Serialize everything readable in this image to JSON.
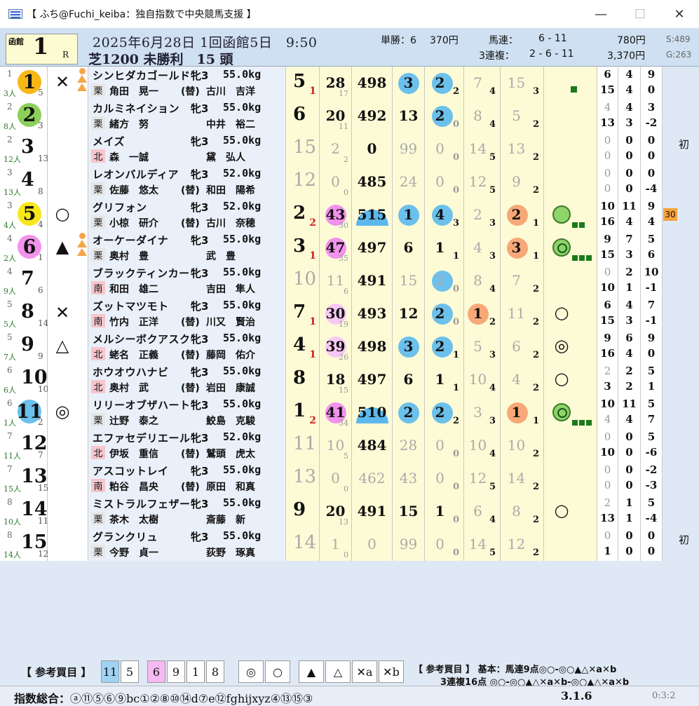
{
  "window": {
    "title": "【 ふち@Fuchi_keiba：独自指数で中央競馬支援 】",
    "minimize": "—",
    "maximize": "☐",
    "close": "✕"
  },
  "race": {
    "venue": "函館",
    "number": "1",
    "r": "R",
    "date_line": "2025年6月28日 1回函館5日　9:50",
    "info_line": "芝1200 未勝利　15 頭"
  },
  "payouts": {
    "tansho_label": "単勝：6",
    "tansho_amount": "370円",
    "umaren_label": "馬連：",
    "umaren_combo": "6 - 11",
    "umaren_amount": "780円",
    "sanrenpuku_label": "3連複：",
    "sanrenpuku_combo": "2 - 6 - 11",
    "sanrenpuku_amount": "3,370円",
    "s_value": "S:489",
    "g_value": "G:263"
  },
  "horses": [
    {
      "waku": "1",
      "pop": "3人",
      "gate": "5",
      "num": "1",
      "numbg": "#f7b715",
      "mark": "✕",
      "tri": true,
      "name": "シンヒダカゴールド",
      "sexage": "牝3",
      "weight": "55.0kg",
      "stable": "栗",
      "stablebg": "#fff",
      "jockey": "角田　晃一",
      "sub": "(替)",
      "trainer": "古川　吉洋",
      "rank": "5",
      "ranksub": "1",
      "odds": "28",
      "oddssub": "17",
      "w": "498",
      "a": "3",
      "abg": "#6cc0ec",
      "b": "2",
      "bbg": "#6cc0ec",
      "bsub": "2",
      "c": "7",
      "csub": "4",
      "d": "15",
      "dsub": "3",
      "e": "sq1",
      "x1": "6",
      "x2": "15",
      "y1": "4",
      "y2": "4",
      "z1": "9",
      "z2": "0",
      "side": ""
    },
    {
      "waku": "2",
      "pop": "8人",
      "gate": "3",
      "num": "2",
      "numbg": "#8cd05a",
      "mark": "",
      "tri": false,
      "name": "カルミネイション",
      "sexage": "牝3",
      "weight": "55.0kg",
      "stable": "栗",
      "stablebg": "#fff",
      "jockey": "緒方　努",
      "sub": "",
      "trainer": "中井　裕二",
      "rank": "6",
      "ranksub": "",
      "odds": "20",
      "oddssub": "11",
      "w": "492",
      "a": "13",
      "abg": "",
      "b": "2",
      "bbg": "#6cc0ec",
      "bsub": "0",
      "c": "8",
      "csub": "4",
      "d": "5",
      "dsub": "2",
      "e": "",
      "x1": "4",
      "x2": "13",
      "y1": "4",
      "y2": "3",
      "z1": "3",
      "z2": "-2",
      "side": ""
    },
    {
      "waku": "2",
      "pop": "12人",
      "gate": "13",
      "num": "3",
      "numbg": "",
      "mark": "",
      "tri": false,
      "name": "メイズ",
      "sexage": "牝3",
      "weight": "55.0kg",
      "stable": "北",
      "stablebg": "#f6c6cc",
      "jockey": "森　一誠",
      "sub": "",
      "trainer": "黛　弘人",
      "rank": "15",
      "ranksub": "",
      "odds": "2",
      "oddssub": "2",
      "w": "0",
      "a": "99",
      "abg": "",
      "b": "0",
      "bbg": "",
      "bsub": "0",
      "c": "14",
      "csub": "5",
      "d": "13",
      "dsub": "2",
      "e": "",
      "x1": "0",
      "x2": "0",
      "y1": "0",
      "y2": "0",
      "z1": "0",
      "z2": "0",
      "side": "初",
      "gray": true
    },
    {
      "waku": "3",
      "pop": "13人",
      "gate": "8",
      "num": "4",
      "numbg": "",
      "mark": "",
      "tri": false,
      "name": "レオンバルディア",
      "sexage": "牝3",
      "weight": "52.0kg",
      "stable": "栗",
      "stablebg": "#fff",
      "jockey": "佐藤　悠太",
      "sub": "(替)",
      "trainer": "和田　陽希",
      "rank": "12",
      "ranksub": "",
      "odds": "0",
      "oddssub": "0",
      "w": "485",
      "a": "24",
      "abg": "",
      "b": "0",
      "bbg": "",
      "bsub": "0",
      "c": "12",
      "csub": "5",
      "d": "9",
      "dsub": "2",
      "e": "",
      "x1": "0",
      "x2": "0",
      "y1": "0",
      "y2": "0",
      "z1": "0",
      "z2": "-4",
      "side": "",
      "gray": true
    },
    {
      "waku": "3",
      "pop": "4人",
      "gate": "4",
      "num": "5",
      "numbg": "#f8e71c",
      "mark": "○",
      "tri": false,
      "name": "グリフォン",
      "sexage": "牝3",
      "weight": "52.0kg",
      "stable": "栗",
      "stablebg": "#fff",
      "jockey": "小椋　研介",
      "sub": "(替)",
      "trainer": "古川　奈穂",
      "rank": "2",
      "ranksub": "2",
      "odds": "43",
      "oddssub": "30",
      "w": "515",
      "a": "1",
      "abg": "#6cc0ec",
      "b": "4",
      "bbg": "#6cc0ec",
      "bsub": "3",
      "c": "2",
      "csub": "3",
      "d": "2",
      "dsub": "1",
      "e": "c2",
      "x1": "10",
      "x2": "16",
      "y1": "11",
      "y2": "4",
      "z1": "9",
      "z2": "4",
      "side": "30",
      "semi": true,
      "oddsbg": "#f292ec"
    },
    {
      "waku": "4",
      "pop": "2人",
      "gate": "1",
      "num": "6",
      "numbg": "#f292ec",
      "mark": "▲",
      "tri": true,
      "name": "オーケーダイナ",
      "sexage": "牝3",
      "weight": "55.0kg",
      "stable": "栗",
      "stablebg": "#fff",
      "jockey": "奥村　豊",
      "sub": "",
      "trainer": "武　豊",
      "rank": "3",
      "ranksub": "1",
      "odds": "47",
      "oddssub": "35",
      "w": "497",
      "a": "6",
      "abg": "",
      "b": "1",
      "bbg": "",
      "bsub": "1",
      "c": "4",
      "csub": "3",
      "d": "3",
      "dsub": "1",
      "e": "c3",
      "x1": "9",
      "x2": "15",
      "y1": "7",
      "y2": "3",
      "z1": "5",
      "z2": "6",
      "side": "",
      "oddsbg": "#f292ec"
    },
    {
      "waku": "4",
      "pop": "9人",
      "gate": "6",
      "num": "7",
      "numbg": "",
      "mark": "",
      "tri": false,
      "name": "ブラックティンカー",
      "sexage": "牝3",
      "weight": "55.0kg",
      "stable": "南",
      "stablebg": "#f6c6cc",
      "jockey": "和田　雄二",
      "sub": "",
      "trainer": "吉田　隼人",
      "rank": "10",
      "ranksub": "",
      "odds": "11",
      "oddssub": "6",
      "w": "491",
      "a": "15",
      "abg": "",
      "b": "2",
      "bbg": "#6cc0ec",
      "bsub": "0",
      "c": "8",
      "csub": "4",
      "d": "7",
      "dsub": "2",
      "e": "",
      "x1": "0",
      "x2": "10",
      "y1": "2",
      "y2": "1",
      "z1": "10",
      "z2": "-1",
      "side": "",
      "gray": true
    },
    {
      "waku": "5",
      "pop": "5人",
      "gate": "14",
      "num": "8",
      "numbg": "",
      "mark": "✕",
      "tri": false,
      "name": "ズットマツモト",
      "sexage": "牝3",
      "weight": "55.0kg",
      "stable": "南",
      "stablebg": "#f6c6cc",
      "jockey": "竹内　正洋",
      "sub": "(替)",
      "trainer": "川又　賢治",
      "rank": "7",
      "ranksub": "1",
      "odds": "30",
      "oddssub": "19",
      "w": "493",
      "a": "12",
      "abg": "",
      "b": "2",
      "bbg": "#6cc0ec",
      "bsub": "0",
      "c": "1",
      "csub": "2",
      "d": "11",
      "dsub": "2",
      "e": "o",
      "x1": "6",
      "x2": "15",
      "y1": "4",
      "y2": "3",
      "z1": "7",
      "z2": "-1",
      "side": "",
      "oddsbg": "#f8c8f4"
    },
    {
      "waku": "5",
      "pop": "7人",
      "gate": "9",
      "num": "9",
      "numbg": "",
      "mark": "△",
      "tri": false,
      "name": "メルシーボクアスク",
      "sexage": "牝3",
      "weight": "55.0kg",
      "stable": "北",
      "stablebg": "#f6c6cc",
      "jockey": "蛯名　正義",
      "sub": "(替)",
      "trainer": "藤岡　佑介",
      "rank": "4",
      "ranksub": "1",
      "odds": "39",
      "oddssub": "26",
      "w": "498",
      "a": "3",
      "abg": "#6cc0ec",
      "b": "2",
      "bbg": "#6cc0ec",
      "bsub": "1",
      "c": "5",
      "csub": "3",
      "d": "6",
      "dsub": "2",
      "e": "oo",
      "x1": "9",
      "x2": "16",
      "y1": "6",
      "y2": "4",
      "z1": "9",
      "z2": "0",
      "side": "",
      "oddsbg": "#f8c8f4"
    },
    {
      "waku": "6",
      "pop": "6人",
      "gate": "10",
      "num": "10",
      "numbg": "",
      "mark": "",
      "tri": false,
      "name": "ホウオウハナビ",
      "sexage": "牝3",
      "weight": "55.0kg",
      "stable": "北",
      "stablebg": "#f6c6cc",
      "jockey": "奥村　武",
      "sub": "(替)",
      "trainer": "岩田　康誠",
      "rank": "8",
      "ranksub": "",
      "odds": "18",
      "oddssub": "15",
      "w": "497",
      "a": "6",
      "abg": "",
      "b": "1",
      "bbg": "",
      "bsub": "1",
      "c": "10",
      "csub": "4",
      "d": "4",
      "dsub": "2",
      "e": "o",
      "x1": "2",
      "x2": "3",
      "y1": "2",
      "y2": "2",
      "z1": "5",
      "z2": "1",
      "side": ""
    },
    {
      "waku": "6",
      "pop": "1人",
      "gate": "2",
      "num": "11",
      "numbg": "#6cc0ec",
      "mark": "◎",
      "tri": false,
      "name": "リリーオブザハート",
      "sexage": "牝3",
      "weight": "55.0kg",
      "stable": "栗",
      "stablebg": "#fff",
      "jockey": "辻野　泰之",
      "sub": "",
      "trainer": "鮫島　克駿",
      "rank": "1",
      "ranksub": "2",
      "odds": "41",
      "oddssub": "34",
      "w": "510",
      "a": "2",
      "abg": "#6cc0ec",
      "b": "2",
      "bbg": "#6cc0ec",
      "bsub": "2",
      "c": "3",
      "csub": "3",
      "d": "1",
      "dsub": "1",
      "e": "c3",
      "x1": "10",
      "x2": "4",
      "y1": "11",
      "y2": "4",
      "z1": "5",
      "z2": "7",
      "side": "",
      "semi": true,
      "oddsbg": "#f292ec"
    },
    {
      "waku": "7",
      "pop": "11人",
      "gate": "7",
      "num": "12",
      "numbg": "",
      "mark": "",
      "tri": false,
      "name": "エファセデリエール",
      "sexage": "牝3",
      "weight": "52.0kg",
      "stable": "北",
      "stablebg": "#f6c6cc",
      "jockey": "伊坂　重信",
      "sub": "(替)",
      "trainer": "鷲頭　虎太",
      "rank": "11",
      "ranksub": "",
      "odds": "10",
      "oddssub": "5",
      "w": "484",
      "a": "28",
      "abg": "",
      "b": "0",
      "bbg": "",
      "bsub": "0",
      "c": "10",
      "csub": "4",
      "d": "10",
      "dsub": "2",
      "e": "",
      "x1": "0",
      "x2": "10",
      "y1": "0",
      "y2": "0",
      "z1": "5",
      "z2": "-6",
      "side": "",
      "gray": true
    },
    {
      "waku": "7",
      "pop": "15人",
      "gate": "15",
      "num": "13",
      "numbg": "",
      "mark": "",
      "tri": false,
      "name": "アスコットレイ",
      "sexage": "牝3",
      "weight": "55.0kg",
      "stable": "南",
      "stablebg": "#f6c6cc",
      "jockey": "粕谷　昌央",
      "sub": "(替)",
      "trainer": "原田　和真",
      "rank": "13",
      "ranksub": "",
      "odds": "0",
      "oddssub": "0",
      "w": "462",
      "a": "43",
      "abg": "",
      "b": "0",
      "bbg": "",
      "bsub": "0",
      "c": "12",
      "csub": "5",
      "d": "14",
      "dsub": "2",
      "e": "",
      "x1": "0",
      "x2": "0",
      "y1": "0",
      "y2": "0",
      "z1": "-2",
      "z2": "-3",
      "side": "",
      "gray": true,
      "wgray": true
    },
    {
      "waku": "8",
      "pop": "10人",
      "gate": "11",
      "num": "14",
      "numbg": "",
      "mark": "",
      "tri": false,
      "name": "ミストラルフェザー",
      "sexage": "牝3",
      "weight": "55.0kg",
      "stable": "栗",
      "stablebg": "#fff",
      "jockey": "茶木　太樹",
      "sub": "",
      "trainer": "斎藤　新",
      "rank": "9",
      "ranksub": "",
      "odds": "20",
      "oddssub": "13",
      "w": "491",
      "a": "15",
      "abg": "",
      "b": "1",
      "bbg": "",
      "bsub": "0",
      "c": "6",
      "csub": "4",
      "d": "8",
      "dsub": "2",
      "e": "o",
      "x1": "2",
      "x2": "13",
      "y1": "1",
      "y2": "1",
      "z1": "5",
      "z2": "-4",
      "side": ""
    },
    {
      "waku": "8",
      "pop": "14人",
      "gate": "12",
      "num": "15",
      "numbg": "",
      "mark": "",
      "tri": false,
      "name": "グランクリュ",
      "sexage": "牝3",
      "weight": "55.0kg",
      "stable": "栗",
      "stablebg": "#fff",
      "jockey": "今野　貞一",
      "sub": "",
      "trainer": "荻野　琢真",
      "rank": "14",
      "ranksub": "",
      "odds": "1",
      "oddssub": "0",
      "w": "0",
      "a": "99",
      "abg": "",
      "b": "0",
      "bbg": "",
      "bsub": "0",
      "c": "14",
      "csub": "5",
      "d": "12",
      "dsub": "2",
      "e": "",
      "x1": "0",
      "x2": "1",
      "y1": "0",
      "y2": "0",
      "z1": "0",
      "z2": "0",
      "side": "初",
      "gray": true,
      "wgray": true
    }
  ],
  "footer": {
    "label": "【 参考買目 】",
    "picks_a": [
      "11",
      "5"
    ],
    "picks_b": [
      "6",
      "9",
      "1",
      "8"
    ],
    "marks": [
      "◎",
      "○",
      "▲",
      "△",
      "✕a",
      "✕b"
    ],
    "ref_label": "【 参考買目 】",
    "ref_basic": "基本：馬連9点◎○-◎○▲△✕a✕b",
    "ref_trio": "3連複16点 ◎○-◎○▲△✕a✕b-◎○▲△✕a✕b",
    "index_label": "指数総合：",
    "index_text": "ⓐ⑪⑤⑥⑨bc①②⑧⑩⑭d⑦e⑫fghijxyz④⑬⑮③",
    "result": "3.1.6",
    "ratio": "0:3:2"
  }
}
